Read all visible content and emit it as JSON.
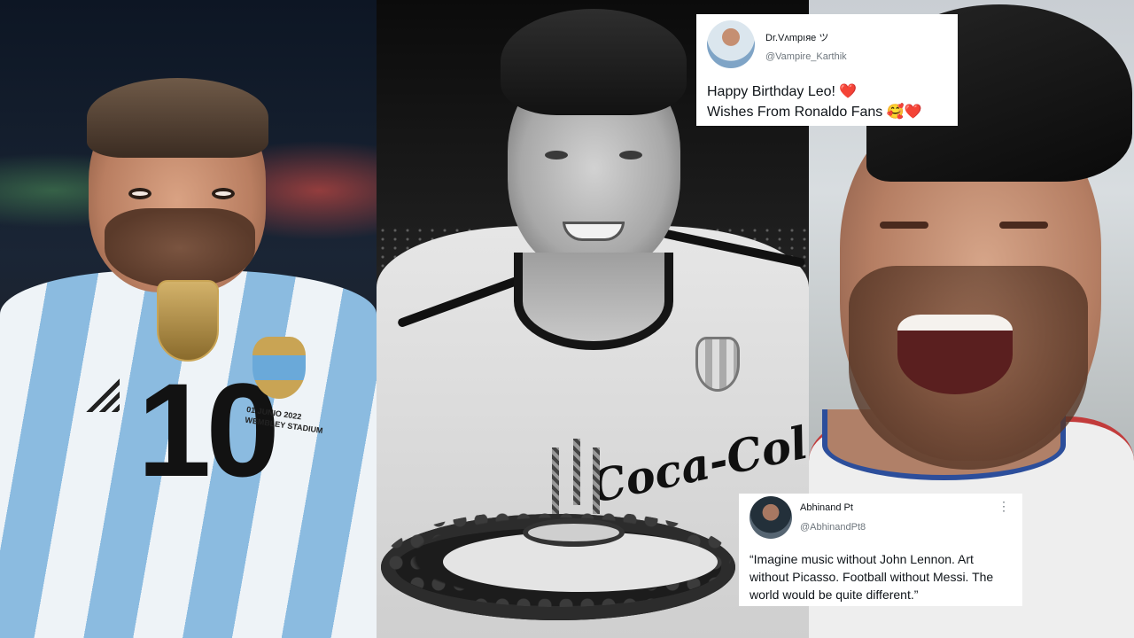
{
  "left_panel": {
    "jersey_number": "10",
    "stadium_text": "01 JUNIO 2022 WEMBLEY STADIUM"
  },
  "middle_panel": {
    "sponsor_text": "Coca-Cola"
  },
  "tweets": [
    {
      "name": "Dr.Vʌmpıяe ツ",
      "handle": "@Vampire_Karthik",
      "line1": "Happy Birthday Leo! ❤️",
      "line2": "Wishes From Ronaldo Fans 🥰❤️"
    },
    {
      "name": "Abhinand Pt",
      "handle": "@AbhinandPt8",
      "more": "⋮",
      "body": "“Imagine music without John Lennon. Art without Picasso. Football without Messi. The world would be quite different.”"
    }
  ]
}
